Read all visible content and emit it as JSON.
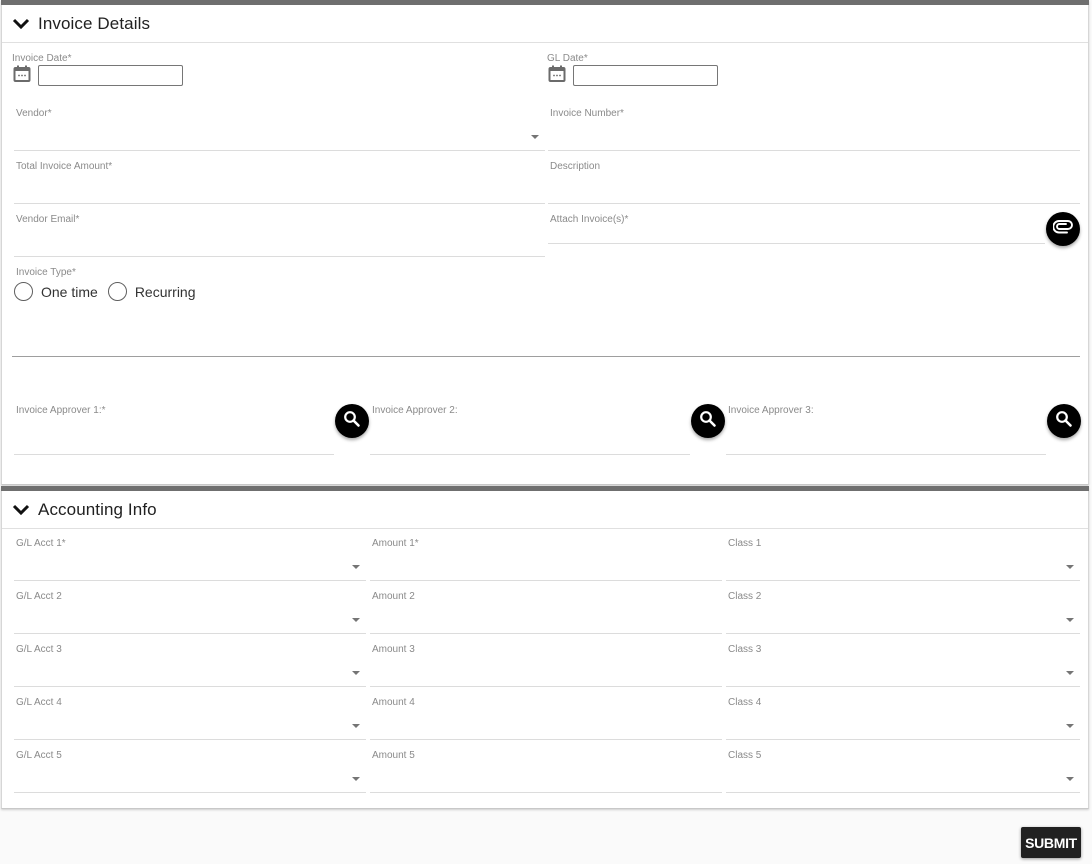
{
  "invoice_details": {
    "title": "Invoice Details",
    "invoice_date": {
      "label": "Invoice Date*",
      "value": ""
    },
    "gl_date": {
      "label": "GL Date*",
      "value": ""
    },
    "vendor": {
      "label": "Vendor*",
      "value": ""
    },
    "invoice_number": {
      "label": "Invoice Number*",
      "value": ""
    },
    "total_invoice_amount": {
      "label": "Total Invoice Amount*",
      "value": ""
    },
    "description": {
      "label": "Description",
      "value": ""
    },
    "vendor_email": {
      "label": "Vendor Email*",
      "value": ""
    },
    "attach_invoices": {
      "label": "Attach Invoice(s)*",
      "icon": "paperclip-icon"
    },
    "invoice_type": {
      "label": "Invoice Type*",
      "options": [
        "One time",
        "Recurring"
      ],
      "selected": null
    },
    "approvers": [
      {
        "label": "Invoice Approver 1:*",
        "value": "",
        "icon": "search-icon"
      },
      {
        "label": "Invoice Approver 2:",
        "value": "",
        "icon": "search-icon"
      },
      {
        "label": "Invoice Approver 3:",
        "value": "",
        "icon": "search-icon"
      }
    ]
  },
  "accounting_info": {
    "title": "Accounting Info",
    "rows": [
      {
        "gl_acct": "G/L Acct 1*",
        "amount": "Amount 1*",
        "class": "Class 1"
      },
      {
        "gl_acct": "G/L Acct 2",
        "amount": "Amount 2",
        "class": "Class 2"
      },
      {
        "gl_acct": "G/L Acct 3",
        "amount": "Amount 3",
        "class": "Class 3"
      },
      {
        "gl_acct": "G/L Acct 4",
        "amount": "Amount 4",
        "class": "Class 4"
      },
      {
        "gl_acct": "G/L Acct 5",
        "amount": "Amount 5",
        "class": "Class 5"
      }
    ]
  },
  "actions": {
    "submit_label": "SUBMIT"
  }
}
